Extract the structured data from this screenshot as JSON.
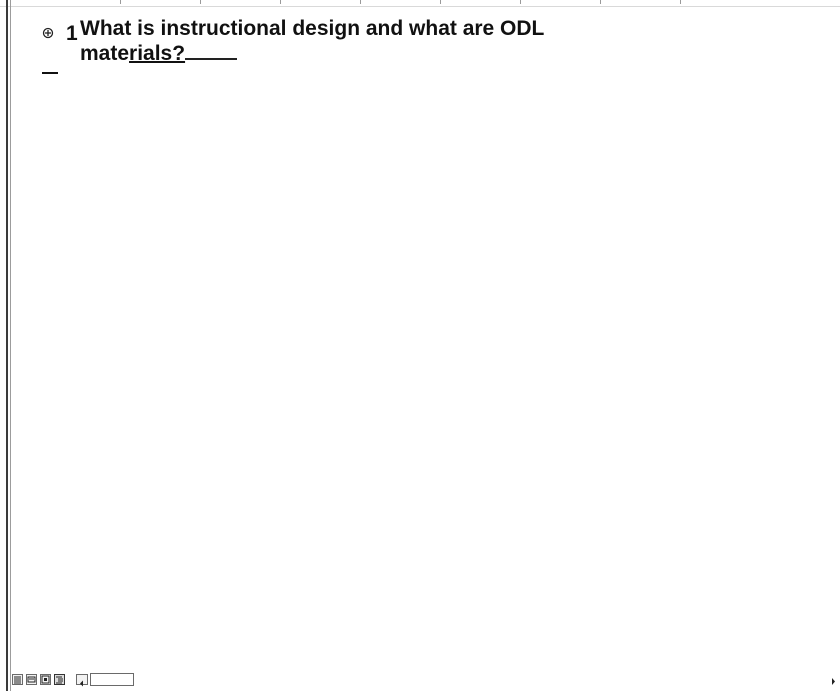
{
  "outline": {
    "items": [
      {
        "number": "1",
        "title_line1": "What is instructional design and what are ODL",
        "title_line2_plain": "mate",
        "title_line2_underlined": "rials?"
      }
    ]
  },
  "statusbar": {
    "view_buttons": [
      "normal-view",
      "outline-view",
      "page-layout-view",
      "master-document-view"
    ],
    "active_view": "master-document-view"
  }
}
